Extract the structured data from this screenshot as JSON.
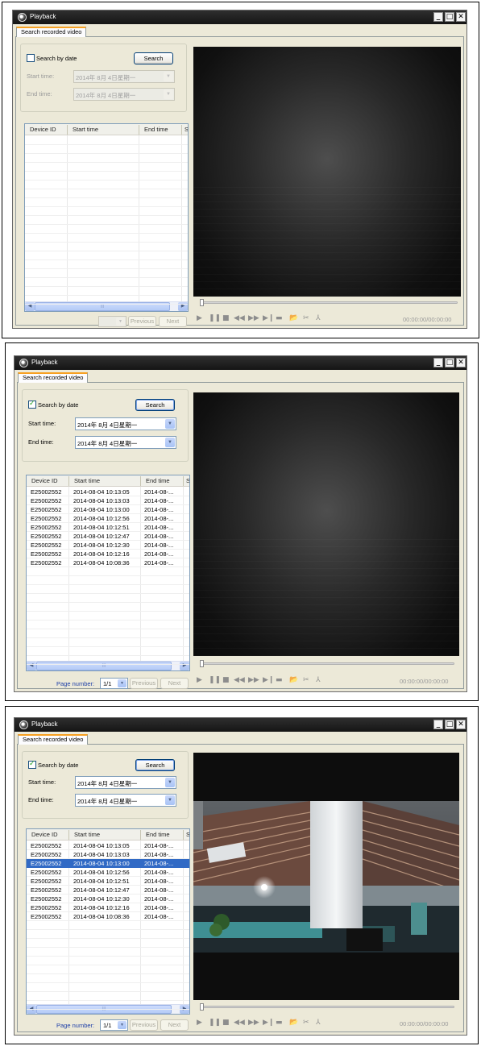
{
  "window_title": "Playback",
  "tab_label": "Search recorded video",
  "search": {
    "checkbox_label": "Search by date",
    "button_label": "Search",
    "start_label": "Start time:",
    "end_label": "End time:",
    "start_value": "2014年  8月  4日星期一",
    "end_value": "2014年  8月  4日星期一"
  },
  "columns": [
    "Device ID",
    "Start time",
    "End time",
    "S"
  ],
  "records": [
    {
      "device": "E25002552",
      "start": "2014-08-04 10:13:05",
      "end": "2014-08-..."
    },
    {
      "device": "E25002552",
      "start": "2014-08-04 10:13:03",
      "end": "2014-08-..."
    },
    {
      "device": "E25002552",
      "start": "2014-08-04 10:13:00",
      "end": "2014-08-..."
    },
    {
      "device": "E25002552",
      "start": "2014-08-04 10:12:56",
      "end": "2014-08-..."
    },
    {
      "device": "E25002552",
      "start": "2014-08-04 10:12:51",
      "end": "2014-08-..."
    },
    {
      "device": "E25002552",
      "start": "2014-08-04 10:12:47",
      "end": "2014-08-..."
    },
    {
      "device": "E25002552",
      "start": "2014-08-04 10:12:30",
      "end": "2014-08-..."
    },
    {
      "device": "E25002552",
      "start": "2014-08-04 10:12:16",
      "end": "2014-08-..."
    },
    {
      "device": "E25002552",
      "start": "2014-08-04 10:08:36",
      "end": "2014-08-..."
    }
  ],
  "pager": {
    "label": "Page number:",
    "page_value": "1/1",
    "previous_label": "Previous",
    "next_label": "Next"
  },
  "timecode": "00:00:00/00:00:00",
  "icons": {
    "play": "▶",
    "pause": "❚❚",
    "stop": "■",
    "rewind": "◀◀",
    "forward": "▶▶",
    "next_frame": "▶❙",
    "snapshot": "▬",
    "open_folder": "📂",
    "scissors": "✂",
    "tool": "⅄",
    "dropdown": "▼",
    "scroll_left": "◀",
    "scroll_right": "▶",
    "grip": "|||",
    "minimize": "_",
    "maximize": "□",
    "close": "✕"
  },
  "screens": [
    {
      "search_by_date_checked": false,
      "result_count": 0,
      "selected_index": null,
      "playing": false
    },
    {
      "search_by_date_checked": true,
      "result_count": 9,
      "selected_index": null,
      "playing": false
    },
    {
      "search_by_date_checked": true,
      "result_count": 9,
      "selected_index": 2,
      "playing": true
    }
  ]
}
